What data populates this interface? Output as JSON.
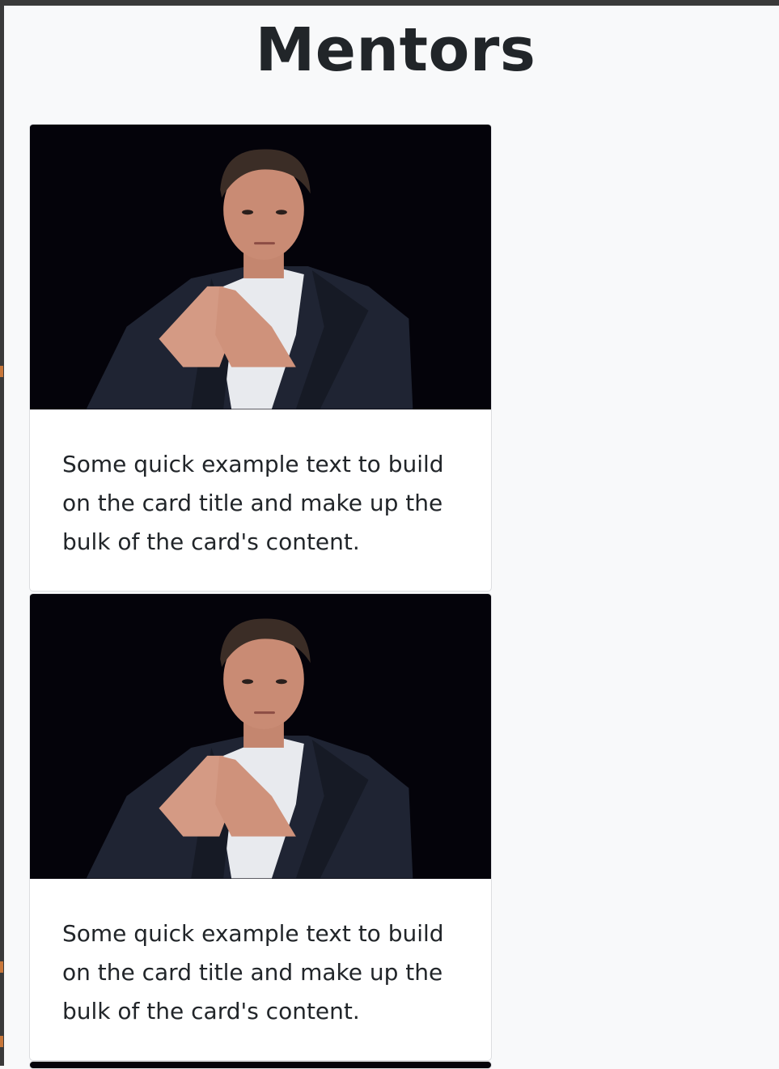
{
  "page": {
    "title": "Mentors"
  },
  "cards": [
    {
      "image_subject": "mentor-portrait",
      "text": "Some quick example text to build on the card title and make up the bulk of the card's content."
    },
    {
      "image_subject": "mentor-portrait",
      "text": "Some quick example text to build on the card title and make up the bulk of the card's content."
    }
  ],
  "colors": {
    "background": "#f8f9fa",
    "text": "#212529",
    "card": "#ffffff",
    "image_backdrop": "#04030a"
  }
}
